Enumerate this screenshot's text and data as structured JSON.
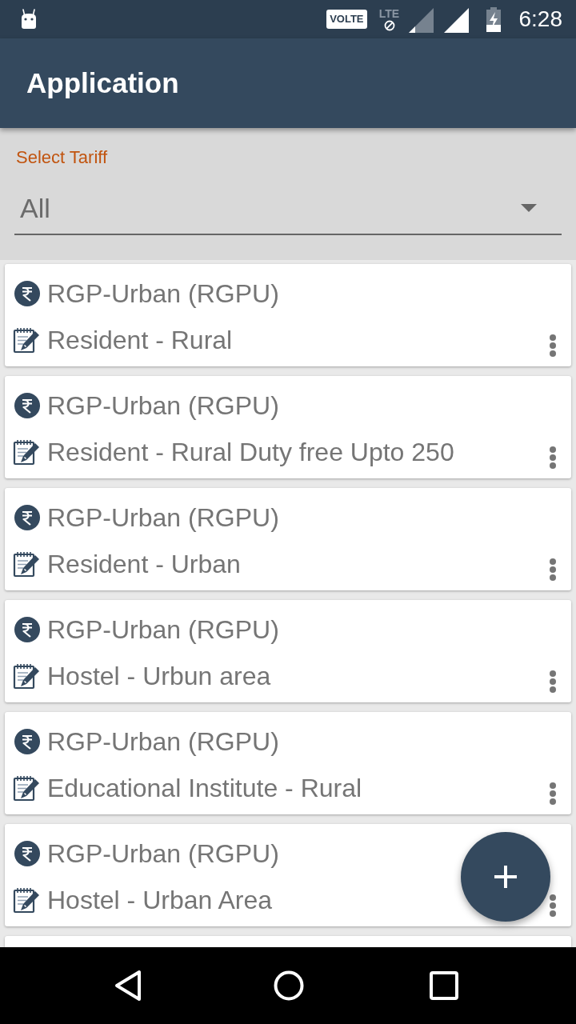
{
  "status_bar": {
    "badge": "VOLTE",
    "network": "LTE",
    "time": "6:28"
  },
  "app_bar": {
    "title": "Application"
  },
  "filter": {
    "label": "Select Tariff",
    "value": "All"
  },
  "tariffs": [
    {
      "category": "RGP-Urban (RGPU)",
      "name": "Resident - Rural"
    },
    {
      "category": "RGP-Urban (RGPU)",
      "name": "Resident - Rural Duty free Upto 250"
    },
    {
      "category": "RGP-Urban (RGPU)",
      "name": "Resident - Urban"
    },
    {
      "category": "RGP-Urban (RGPU)",
      "name": "Hostel - Urbun area"
    },
    {
      "category": "RGP-Urban (RGPU)",
      "name": "Educational Institute - Rural"
    },
    {
      "category": "RGP-Urban (RGPU)",
      "name": "Hostel - Urban Area"
    }
  ]
}
